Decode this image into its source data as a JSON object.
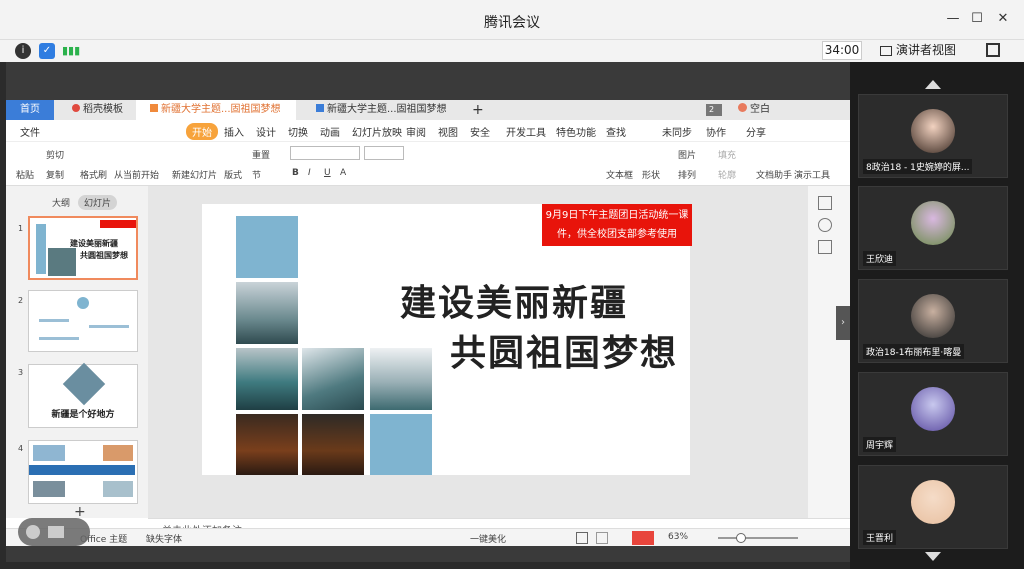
{
  "window": {
    "title": "腾讯会议",
    "minimize": "—",
    "maximize": "☐",
    "close": "✕"
  },
  "statusbar": {
    "timer": "34:00",
    "presenter_view": "演讲者视图",
    "presenter_dropdown": "▾"
  },
  "wps": {
    "tabs": [
      {
        "label": "首页"
      },
      {
        "label": "稻壳模板"
      },
      {
        "label": "新疆大学主题...固祖国梦想"
      },
      {
        "label": "新疆大学主题...固祖国梦想"
      }
    ],
    "add_tab": "+",
    "badge": "2",
    "user_label": "空白",
    "menu": [
      "文件",
      "开始",
      "插入",
      "设计",
      "切换",
      "动画",
      "幻灯片放映",
      "审阅",
      "视图",
      "安全",
      "开发工具",
      "特色功能",
      "查找",
      "未同步",
      "协作",
      "分享"
    ],
    "toolbar": {
      "paste": "粘贴",
      "cut": "剪切",
      "copy": "复制",
      "format_painter": "格式刷",
      "from_current": "从当前开始",
      "new_slide": "新建幻灯片",
      "layout": "版式",
      "section": "节",
      "reset": "重置",
      "textbox": "文本框",
      "shape": "形状",
      "arrange": "排列",
      "picture": "图片",
      "fill": "填充",
      "outline": "轮廓",
      "doc_helper": "文档助手",
      "present_tools": "演示工具"
    },
    "side_tabs": {
      "outline": "大纲",
      "slides": "幻灯片"
    },
    "thumbnails": [
      {
        "num": "1",
        "line1": "建设美丽新疆",
        "line2": "共圆祖国梦想"
      },
      {
        "num": "2"
      },
      {
        "num": "3",
        "caption": "新疆是个好地方"
      },
      {
        "num": "4"
      }
    ],
    "add_slide": "+",
    "notes_placeholder": "单击此处添加备注",
    "bottom": {
      "theme": "Office 主题",
      "missing_font": "缺失字体",
      "beautify": "一键美化",
      "zoom": "63%"
    }
  },
  "slide": {
    "notice": "9月9日下午主题团日活动统一课件，供全校团支部参考使用",
    "title_line1": "建设美丽新疆",
    "title_line2": "共圆祖国梦想"
  },
  "participants": [
    {
      "name": "8政治18 - 1史婉婷的屏..."
    },
    {
      "name": "王欣迪"
    },
    {
      "name": "政治18-1布丽布里·喀曼"
    },
    {
      "name": "周宇辉"
    },
    {
      "name": "王晋利"
    }
  ],
  "colors": {
    "accent_blue": "#3b7dd8",
    "start_orange": "#f7a33c",
    "notice_red": "#e8140b",
    "tile_blue": "#7fb4d0"
  }
}
